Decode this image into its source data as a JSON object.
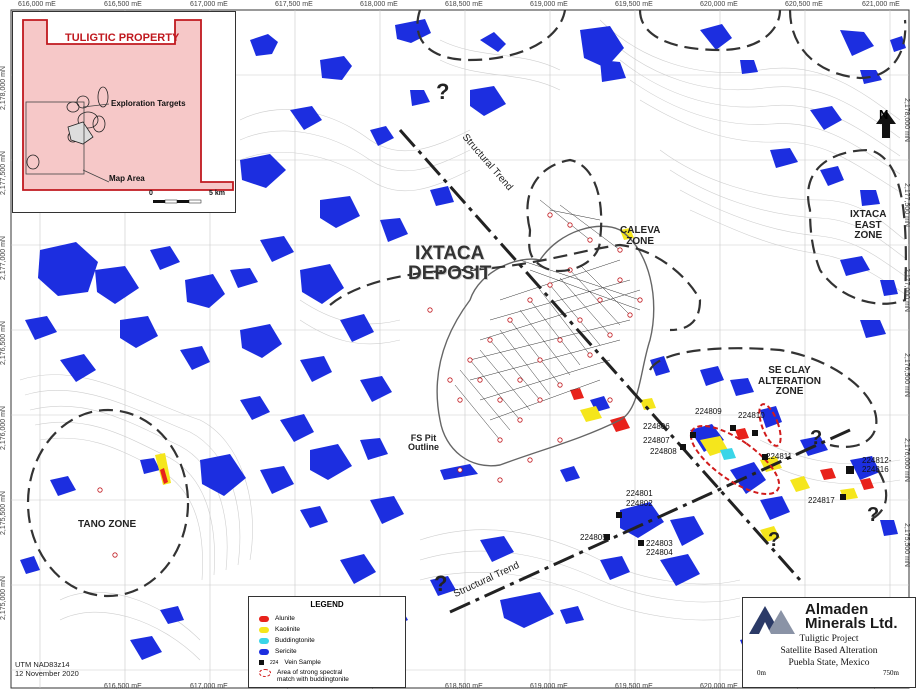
{
  "grid": {
    "eastings": [
      "616,000 mE",
      "616,500 mE",
      "617,000 mE",
      "617,500 mE",
      "618,000 mE",
      "618,500 mE",
      "619,000 mE",
      "619,500 mE",
      "620,000 mE",
      "620,500 mE",
      "621,000 mE"
    ],
    "northings": [
      "2,178,000 mN",
      "2,177,500 mN",
      "2,177,000 mN",
      "2,176,500 mN",
      "2,176,000 mN",
      "2,175,500 mN",
      "2,175,000 mN",
      "2,174,500 mN"
    ]
  },
  "zones": {
    "ixtaca_line1": "IXTACA",
    "ixtaca_line2": "DEPOSIT",
    "caleva_line1": "CALEVA",
    "caleva_line2": "ZONE",
    "ixtaca_east_line1": "IXTACA",
    "ixtaca_east_line2": "EAST",
    "ixtaca_east_line3": "ZONE",
    "se_clay_line1": "SE CLAY",
    "se_clay_line2": "ALTERATION",
    "se_clay_line3": "ZONE",
    "tano": "TANO ZONE",
    "fs_pit_line1": "FS Pit",
    "fs_pit_line2": "Outline"
  },
  "structural_trend": "Structural Trend",
  "question_mark": "?",
  "north_label": "N",
  "samples": [
    "224809",
    "224810",
    "224806",
    "224807",
    "224808",
    "224811",
    "224812-",
    "224816",
    "224817",
    "224801",
    "224802",
    "224805",
    "224803",
    "224804"
  ],
  "legend": {
    "title": "LEGEND",
    "items": [
      {
        "label": "Alunite",
        "color": "#e8221b"
      },
      {
        "label": "Kaolinite",
        "color": "#f5e61c"
      },
      {
        "label": "Buddingtonite",
        "color": "#3ad5e8"
      },
      {
        "label": "Sericite",
        "color": "#1c2ee0"
      }
    ],
    "vein_number": "224",
    "vein_label": "Vein Sample",
    "spectral_line1": "Area of strong spectral",
    "spectral_line2": "match with buddingtonite"
  },
  "inset": {
    "title": "TULIGTIC PROPERTY",
    "exploration_targets": "Exploration Targets",
    "map_area": "Map Area",
    "scale_zero": "0",
    "scale_five": "5 km"
  },
  "titlebox": {
    "company_line1": "Almaden",
    "company_line2": "Minerals Ltd.",
    "project": "Tuligtic Project",
    "subtitle": "Satellite Based Alteration",
    "location": "Puebla State, Mexico",
    "scale_zero": "0m",
    "scale_end": "750m"
  },
  "footer": {
    "utm": "UTM NAD83z14",
    "date": "12 November 2020"
  },
  "colors": {
    "sericite": "#1c2ee0",
    "alunite": "#e8221b",
    "kaolinite": "#f5e61c",
    "buddingtonite": "#3ad5e8",
    "property": "#c0191f"
  }
}
